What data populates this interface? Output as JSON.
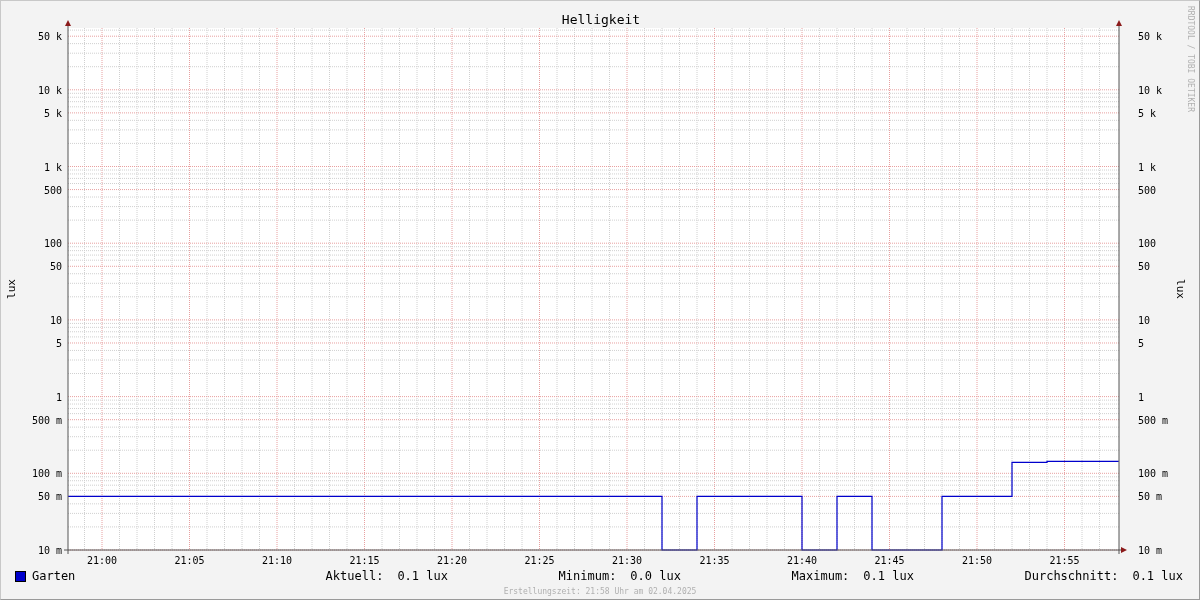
{
  "graph": {
    "title": "Helligkeit",
    "left_axis_label": "lux",
    "right_axis_label": "lux",
    "credit": "RRDTOOL / TOBI OETIKER",
    "left_tick_labels": [
      "50 k",
      "10 k",
      "5 k",
      "1 k",
      "500",
      "100",
      "50",
      "10",
      "5",
      "1",
      "500 m",
      "100 m",
      "50 m",
      "10 m"
    ],
    "right_tick_labels": [
      "50 k",
      "10 k",
      "5 k",
      "1 k",
      "500",
      "100",
      "50",
      "10",
      "5",
      "1",
      "500 m",
      "100 m",
      "50 m",
      "10 m"
    ],
    "x_tick_labels": [
      "21:00",
      "21:05",
      "21:10",
      "21:15",
      "21:20",
      "21:25",
      "21:30",
      "21:35",
      "21:40",
      "21:45",
      "21:50",
      "21:55"
    ]
  },
  "legend": {
    "series_name": "Garten",
    "color": "#0000cc",
    "stats": [
      {
        "label": "Aktuell:",
        "value": "0.1 lux"
      },
      {
        "label": "Minimum:",
        "value": "0.0 lux"
      },
      {
        "label": "Maximum:",
        "value": "0.1 lux"
      },
      {
        "label": "Durchschnitt:",
        "value": "0.1 lux"
      }
    ]
  },
  "footer": "Erstellungszeit: 21:58 Uhr am 02.04.2025"
}
